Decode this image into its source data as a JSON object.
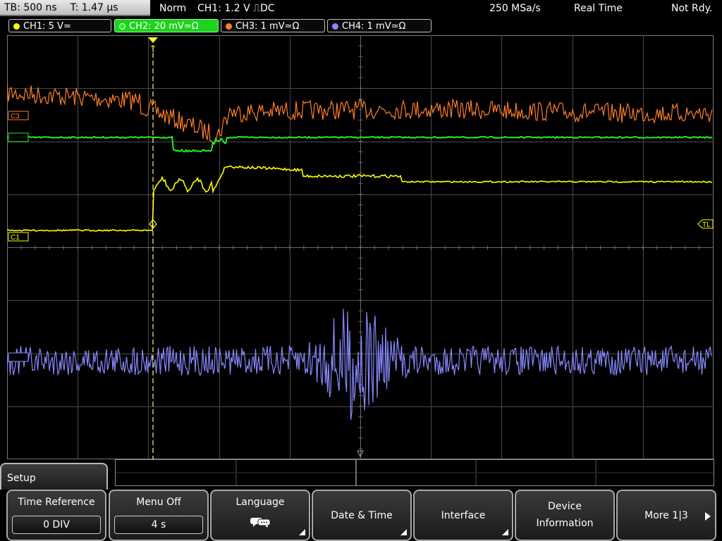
{
  "status": {
    "timebase": "TB: 500 ns",
    "trigger_time": "T: 1.47 µs",
    "mode": "Norm",
    "trigger_source": "CH1: 1.2 V",
    "trigger_coupling": "DC",
    "sample_rate": "250 MSa/s",
    "acquisition": "Real Time",
    "state": "Not Rdy."
  },
  "channels": [
    {
      "label": "CH1: 5 V",
      "coupling_sym": "≃",
      "color": "#ffff00"
    },
    {
      "label": "CH2: 20 mV",
      "coupling_sym": "≃Ω",
      "color": "#22ee22"
    },
    {
      "label": "CH3: 1 mV",
      "coupling_sym": "≃Ω",
      "color": "#ff7f27"
    },
    {
      "label": "CH4: 1 mV",
      "coupling_sym": "≃Ω",
      "color": "#8888ff"
    }
  ],
  "markers": {
    "c1": "C1",
    "c3": "C3",
    "tl": "TL",
    "trigger": "T"
  },
  "menu": {
    "title": "Setup",
    "softkeys": [
      {
        "label": "Time Reference",
        "value": "0 DIV"
      },
      {
        "label": "Menu Off",
        "value": "4 s"
      },
      {
        "label": "Language",
        "icon": "speech-bubble-icon"
      },
      {
        "label": "Date & Time"
      },
      {
        "label": "Interface"
      },
      {
        "label": "Device",
        "label2": "Information"
      },
      {
        "label": "More 1|3"
      }
    ]
  },
  "colors": {
    "grid": "#5a5a5a",
    "trigger_line": "#ffff66",
    "active_tab": "#1ed21e"
  }
}
